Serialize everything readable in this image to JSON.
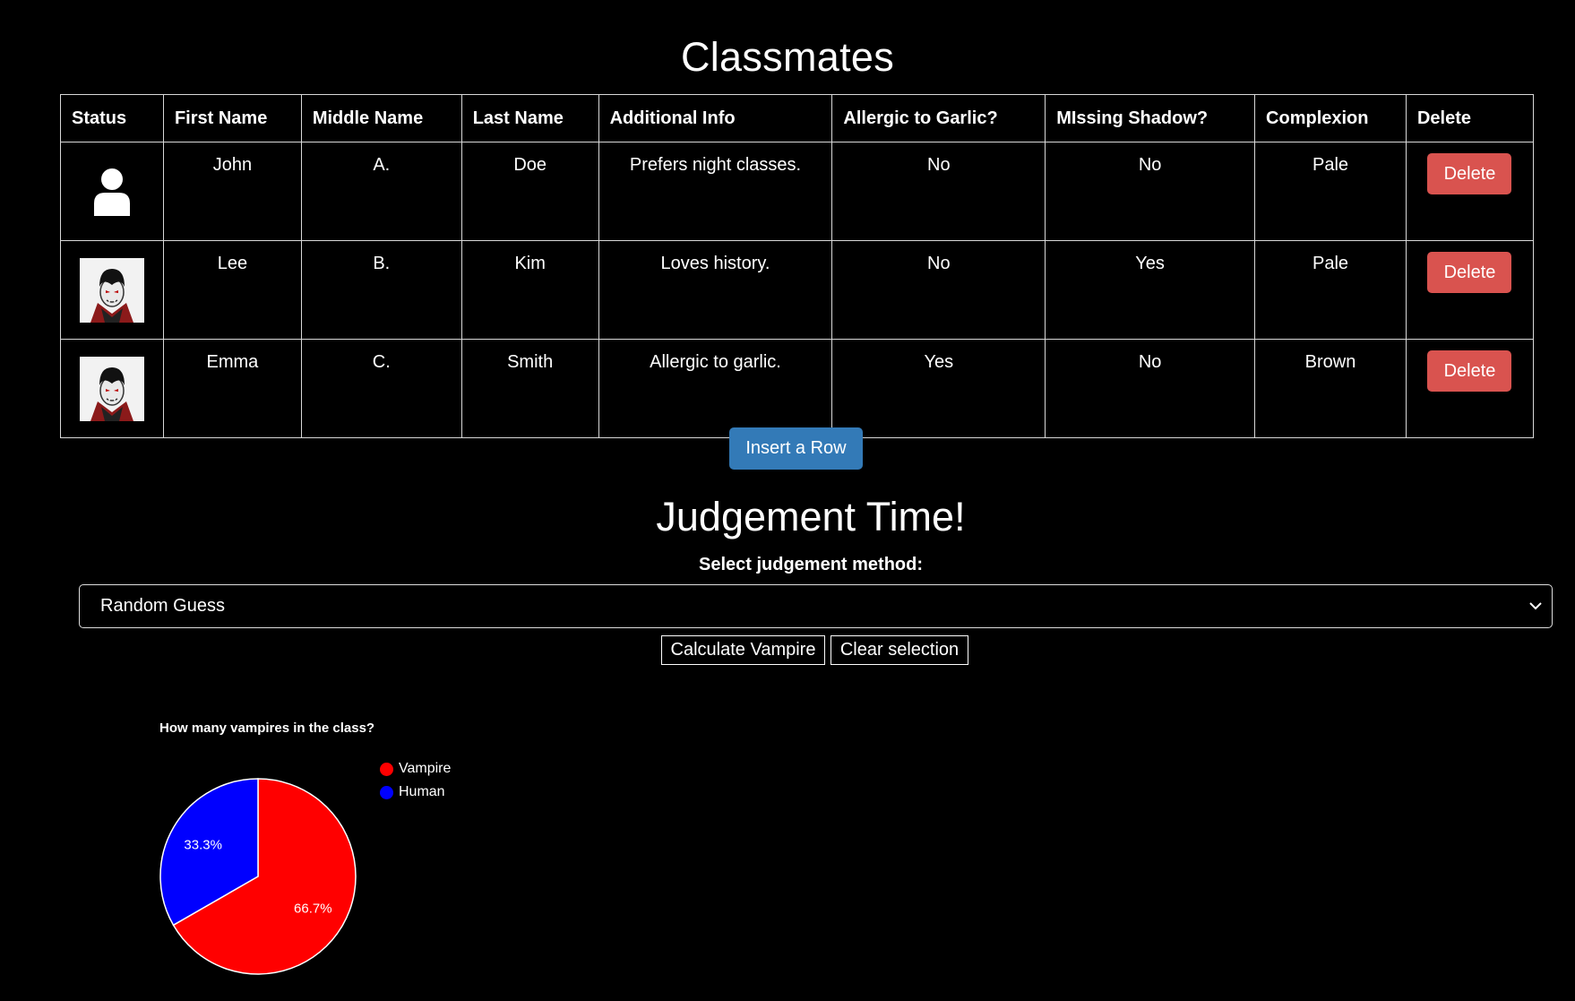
{
  "page": {
    "title": "Classmates",
    "judgement_title": "Judgement Time!",
    "select_label": "Select judgement method:"
  },
  "table": {
    "headers": [
      "Status",
      "First Name",
      "Middle Name",
      "Last Name",
      "Additional Info",
      "Allergic to Garlic?",
      "MIssing Shadow?",
      "Complexion",
      "Delete"
    ],
    "rows": [
      {
        "status_icon": "person-icon",
        "first": "John",
        "middle": "A.",
        "last": "Doe",
        "info": "Prefers night classes.",
        "garlic": "No",
        "shadow": "No",
        "complexion": "Pale",
        "delete_label": "Delete"
      },
      {
        "status_icon": "vampire-icon",
        "first": "Lee",
        "middle": "B.",
        "last": "Kim",
        "info": "Loves history.",
        "garlic": "No",
        "shadow": "Yes",
        "complexion": "Pale",
        "delete_label": "Delete"
      },
      {
        "status_icon": "vampire-icon",
        "first": "Emma",
        "middle": "C.",
        "last": "Smith",
        "info": "Allergic to garlic.",
        "garlic": "Yes",
        "shadow": "No",
        "complexion": "Brown",
        "delete_label": "Delete"
      }
    ]
  },
  "buttons": {
    "insert_row": "Insert a Row",
    "calculate": "Calculate Vampire",
    "clear": "Clear selection"
  },
  "select": {
    "value": "Random Guess"
  },
  "colors": {
    "delete": "#d9534f",
    "insert": "#337ab7",
    "vampire": "#ff0000",
    "human": "#0000ff"
  },
  "chart_data": {
    "type": "pie",
    "title": "How many vampires in the class?",
    "categories": [
      "Vampire",
      "Human"
    ],
    "values": [
      66.7,
      33.3
    ],
    "labels": [
      "66.7%",
      "33.3%"
    ],
    "colors": [
      "#ff0000",
      "#0000ff"
    ],
    "legend_position": "top-right"
  }
}
